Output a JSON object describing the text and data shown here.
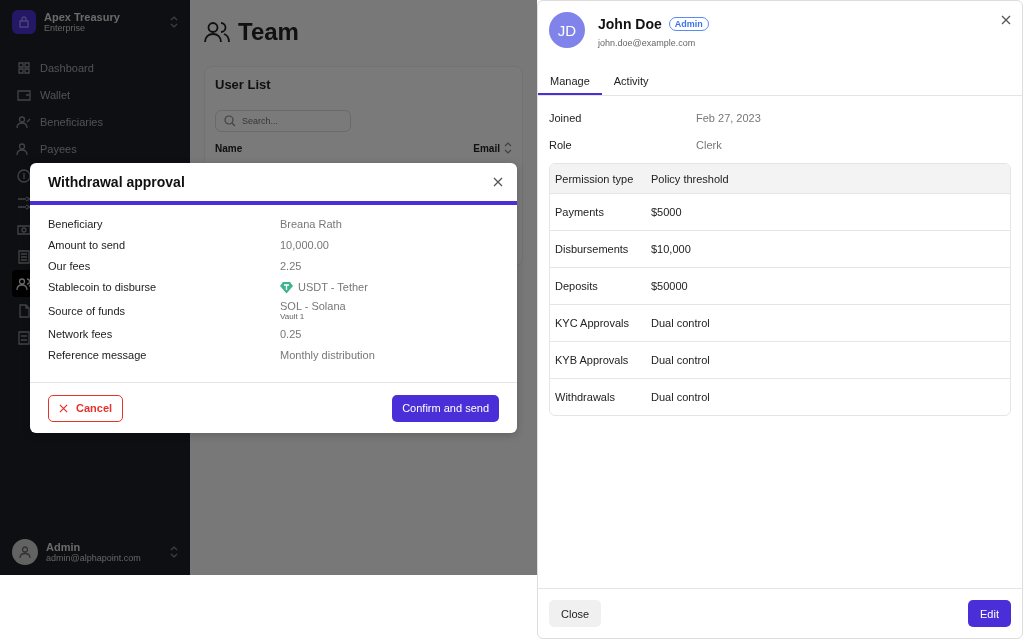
{
  "sidebar": {
    "org_name": "Apex Treasury",
    "org_plan": "Enterprise",
    "nav_items": [
      {
        "label": "Dashboard",
        "selected": false
      },
      {
        "label": "Wallet",
        "selected": false
      },
      {
        "label": "Beneficiaries",
        "selected": false
      },
      {
        "label": "Payees",
        "selected": false
      },
      {
        "selected": false
      },
      {
        "selected": false
      },
      {
        "selected": false
      },
      {
        "selected": false
      },
      {
        "selected": true
      },
      {
        "selected": false
      },
      {
        "selected": false
      }
    ],
    "user": {
      "name": "Admin",
      "email": "admin@alphapoint.com"
    }
  },
  "page": {
    "title": "Team",
    "card_title": "User List",
    "search": {
      "placeholder": "Search..."
    },
    "columns": [
      "Name",
      "Email"
    ]
  },
  "modal": {
    "title": "Withdrawal approval",
    "rows": [
      {
        "label": "Beneficiary",
        "value": "Breana Rath"
      },
      {
        "label": "Amount to send",
        "value": "10,000.00"
      },
      {
        "label": "Our fees",
        "value": "2.25"
      },
      {
        "label": "Stablecoin to disburse",
        "value": "USDT - Tether",
        "kind": "coin"
      },
      {
        "label": "Source of funds",
        "value": "SOL - Solana",
        "sub": "Vault 1"
      },
      {
        "label": "Network fees",
        "value": "0.25"
      },
      {
        "label": "Reference message",
        "value": "Monthly distribution"
      }
    ],
    "buttons": {
      "cancel": "Cancel",
      "confirm": "Confirm and send"
    }
  },
  "drawer": {
    "initials": "JD",
    "name": "John Doe",
    "badge": "Admin",
    "email": "john.doe@example.com",
    "tabs": [
      {
        "label": "Manage",
        "selected": true
      },
      {
        "label": "Activity",
        "selected": false
      }
    ],
    "fields": [
      {
        "label": "Joined",
        "value": "Feb 27, 2023"
      },
      {
        "label": "Role",
        "value": "Clerk"
      }
    ],
    "table": {
      "columns": [
        "Permission type",
        "Policy threshold"
      ],
      "rows": [
        [
          "Payments",
          "$5000"
        ],
        [
          "Disbursements",
          "$10,000"
        ],
        [
          "Deposits",
          "$50000"
        ],
        [
          "KYC Approvals",
          "Dual control"
        ],
        [
          "KYB Approvals",
          "Dual control"
        ],
        [
          "Withdrawals",
          "Dual control"
        ]
      ]
    },
    "buttons": {
      "close": "Close",
      "edit": "Edit"
    }
  }
}
